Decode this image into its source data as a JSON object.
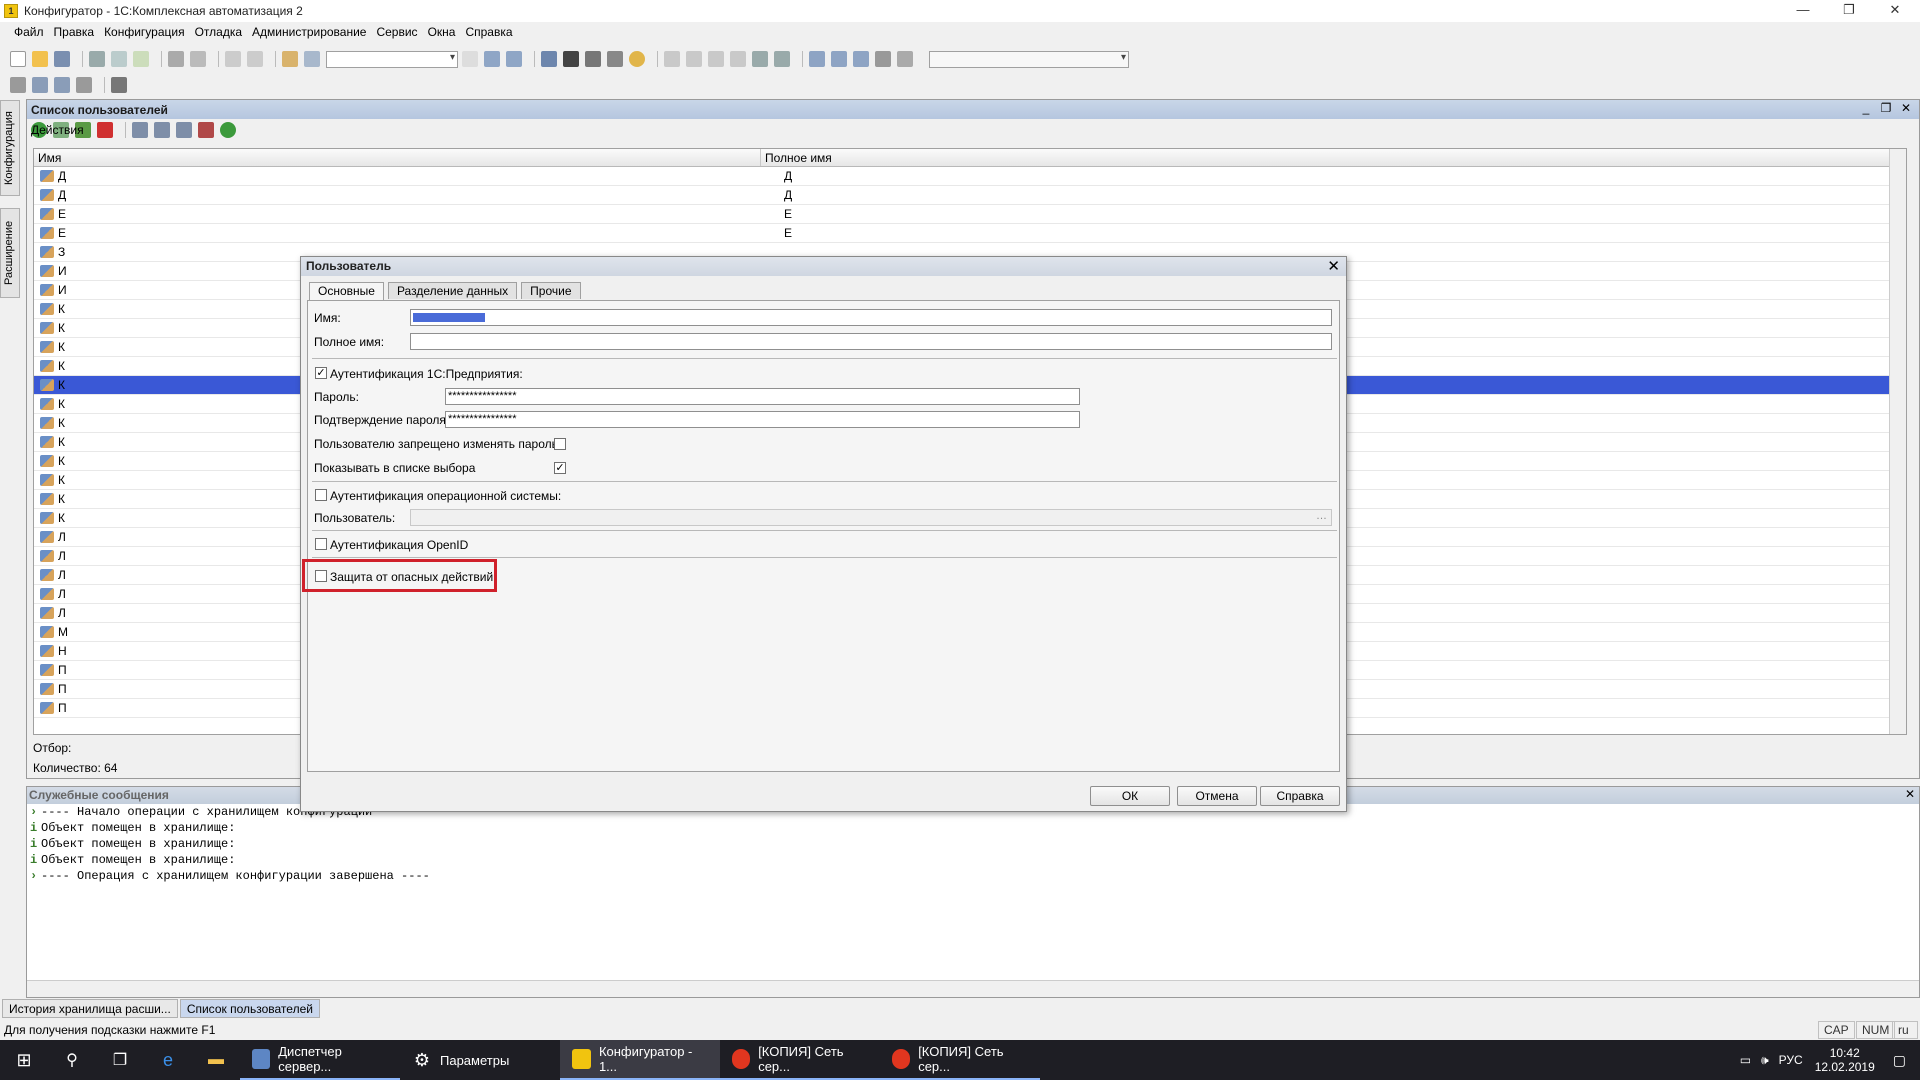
{
  "window": {
    "title": "Конфигуратор - 1С:Комплексная автоматизация 2"
  },
  "menu": [
    "Файл",
    "Правка",
    "Конфигурация",
    "Отладка",
    "Администрирование",
    "Сервис",
    "Окна",
    "Справка"
  ],
  "left_tabs": [
    "Конфигурация",
    "Расширение"
  ],
  "users_window": {
    "title": "Список пользователей",
    "actions_label": "Действия",
    "columns": [
      "Имя",
      "Полное имя"
    ],
    "rows": [
      {
        "name": "Д",
        "full": "Д"
      },
      {
        "name": "Д",
        "full": "Д"
      },
      {
        "name": "Е",
        "full": "Е"
      },
      {
        "name": "Е",
        "full": "Е"
      },
      {
        "name": "З",
        "full": ""
      },
      {
        "name": "И",
        "full": ""
      },
      {
        "name": "И",
        "full": ""
      },
      {
        "name": "К",
        "full": ""
      },
      {
        "name": "К",
        "full": ""
      },
      {
        "name": "К",
        "full": ""
      },
      {
        "name": "К",
        "full": ""
      },
      {
        "name": "К",
        "full": ""
      },
      {
        "name": "К",
        "full": ""
      },
      {
        "name": "К",
        "full": ""
      },
      {
        "name": "К",
        "full": ""
      },
      {
        "name": "К",
        "full": ""
      },
      {
        "name": "К",
        "full": ""
      },
      {
        "name": "К",
        "full": ""
      },
      {
        "name": "К",
        "full": ""
      },
      {
        "name": "Л",
        "full": ""
      },
      {
        "name": "Л",
        "full": ""
      },
      {
        "name": "Л",
        "full": ""
      },
      {
        "name": "Л",
        "full": ""
      },
      {
        "name": "Л",
        "full": ""
      },
      {
        "name": "М",
        "full": ""
      },
      {
        "name": "Н",
        "full": ""
      },
      {
        "name": "П",
        "full": ""
      },
      {
        "name": "П",
        "full": ""
      },
      {
        "name": "П",
        "full": ""
      }
    ],
    "filter_label": "Отбор:",
    "count_label": "Количество: 64"
  },
  "dialog": {
    "title": "Пользователь",
    "tabs": [
      "Основные",
      "Разделение данных",
      "Прочие"
    ],
    "name_label": "Имя:",
    "fullname_label": "Полное имя:",
    "auth_1c_label": "Аутентификация 1С:Предприятия:",
    "password_label": "Пароль:",
    "password_value": "****************",
    "confirm_label": "Подтверждение пароля:",
    "confirm_value": "****************",
    "forbid_change_label": "Пользователю запрещено изменять пароль",
    "show_in_list_label": "Показывать в списке выбора",
    "auth_os_label": "Аутентификация операционной системы:",
    "os_user_label": "Пользователь:",
    "openid_label": "Аутентификация OpenID",
    "protection_label": "Защита от опасных действий",
    "ok": "ОК",
    "cancel": "Отмена",
    "help": "Справка",
    "checks": {
      "auth_1c": true,
      "forbid_change": false,
      "show_in_list": true,
      "auth_os": false,
      "openid": false,
      "protection": false
    }
  },
  "messages": {
    "title": "Служебные сообщения",
    "lines": [
      "---- Начало операции с хранилищем конфигурации",
      "Объект помещен в хранилище:",
      "Объект помещен в хранилище:",
      "Объект помещен в хранилище:",
      "---- Операция с хранилищем конфигурации завершена ----"
    ]
  },
  "window_tabs": [
    "История хранилища расши...",
    "Список пользователей"
  ],
  "status": {
    "hint": "Для получения подсказки нажмите F1",
    "cap": "CAP",
    "num": "NUM",
    "lang": "ru"
  },
  "taskbar": {
    "apps": [
      "Диспетчер сервер...",
      "Параметры",
      "Конфигуратор - 1...",
      "[КОПИЯ] Сеть сер...",
      "[КОПИЯ] Сеть сер..."
    ],
    "lang": "РУС",
    "time": "10:42",
    "date": "12.02.2019"
  },
  "colors": {
    "selection": "#3a58d6",
    "highlight_box": "#d0212b",
    "taskbar": "#1e1e24"
  }
}
